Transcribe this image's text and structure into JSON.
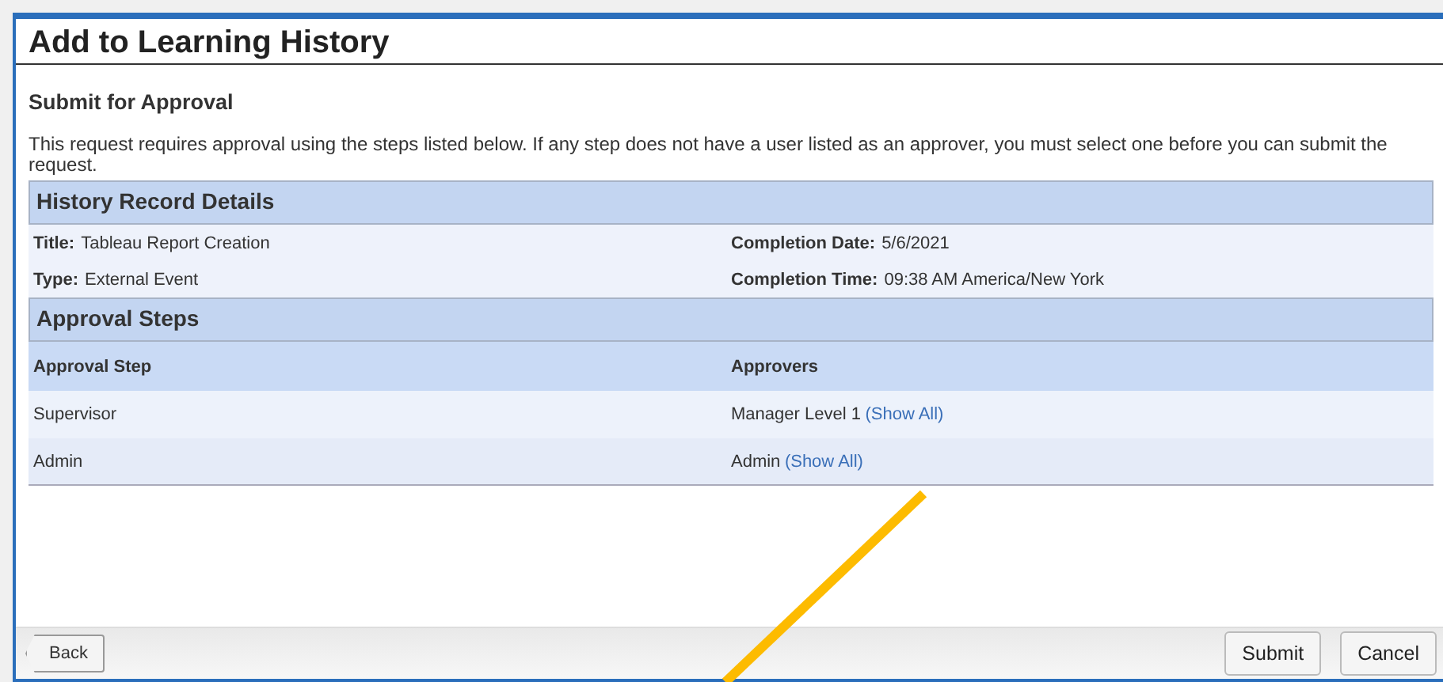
{
  "window": {
    "title": "Add to Learning History"
  },
  "section_title": "Submit for Approval",
  "instructions": "This request requires approval using the steps listed below. If any step does not have a user listed as an approver, you must select one before you can submit the request.",
  "details": {
    "heading": "History Record Details",
    "fields": [
      {
        "label": "Title:",
        "value": "Tableau Report Creation"
      },
      {
        "label": "Completion Date:",
        "value": "5/6/2021"
      },
      {
        "label": "Type:",
        "value": "External Event"
      },
      {
        "label": "Completion Time:",
        "value": "09:38 AM America/New York"
      }
    ]
  },
  "approval_steps": {
    "heading": "Approval Steps",
    "columns": [
      "Approval Step",
      "Approvers"
    ],
    "rows": [
      {
        "step": "Supervisor",
        "approver": "Manager Level 1",
        "link": "(Show All)"
      },
      {
        "step": "Admin",
        "approver": "Admin",
        "link": "(Show All)"
      }
    ]
  },
  "footer": {
    "back": "Back",
    "buttons": [
      "Submit",
      "Cancel"
    ]
  }
}
